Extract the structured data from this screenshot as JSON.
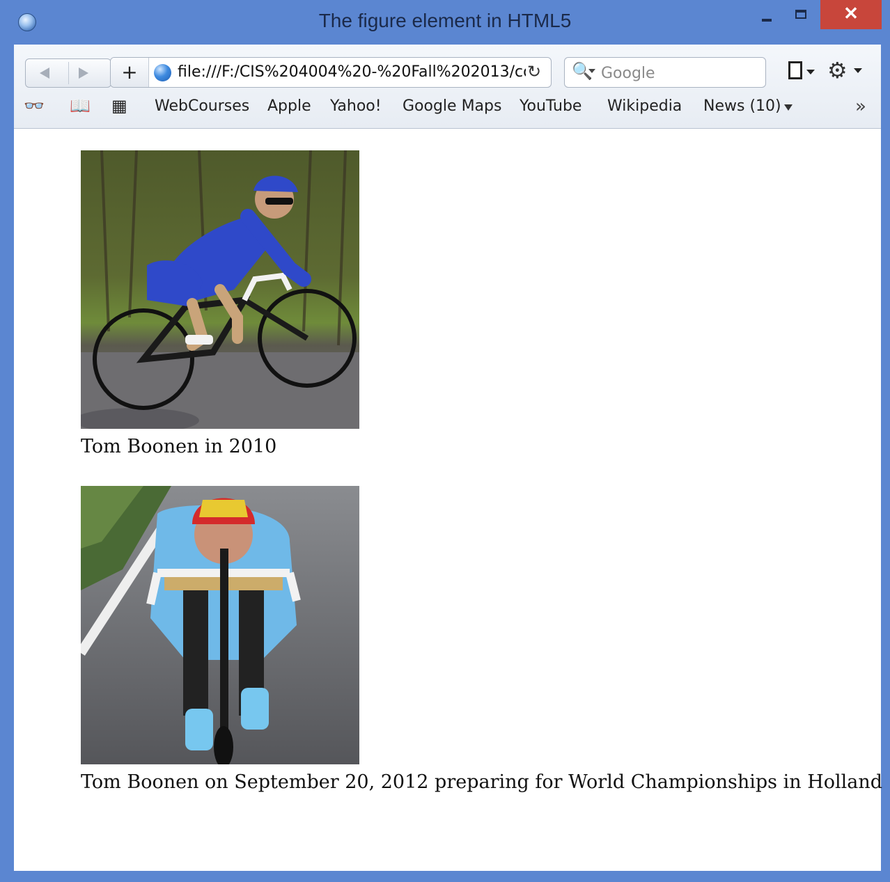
{
  "window": {
    "title": "The figure element in HTML5",
    "close_glyph": "✕"
  },
  "toolbar": {
    "add_glyph": "+",
    "address": "file:///F:/CIS%204004%20-%20Fall%202013/coc",
    "reload_glyph": "↻",
    "search_placeholder": "Google",
    "search_glyph": "🔍",
    "gear_glyph": "⚙",
    "reading_list_glyph": "👓",
    "bookmarks_glyph": "📖",
    "top_sites_glyph": "▦",
    "more_glyph": "»"
  },
  "bookmarks": [
    {
      "label": "WebCourses"
    },
    {
      "label": "Apple"
    },
    {
      "label": "Yahoo!"
    },
    {
      "label": "Google Maps"
    },
    {
      "label": "YouTube"
    },
    {
      "label": "Wikipedia"
    },
    {
      "label": "News (10)"
    }
  ],
  "figures": [
    {
      "caption": "Tom Boonen in 2010"
    },
    {
      "caption": "Tom Boonen on September 20, 2012 preparing for World Championships in Holland"
    }
  ],
  "colors": {
    "window_frame": "#5b86d1",
    "close_button": "#c8463b",
    "jersey_blue": "#2f49c9",
    "jersey_light_blue": "#6fb9e8"
  }
}
